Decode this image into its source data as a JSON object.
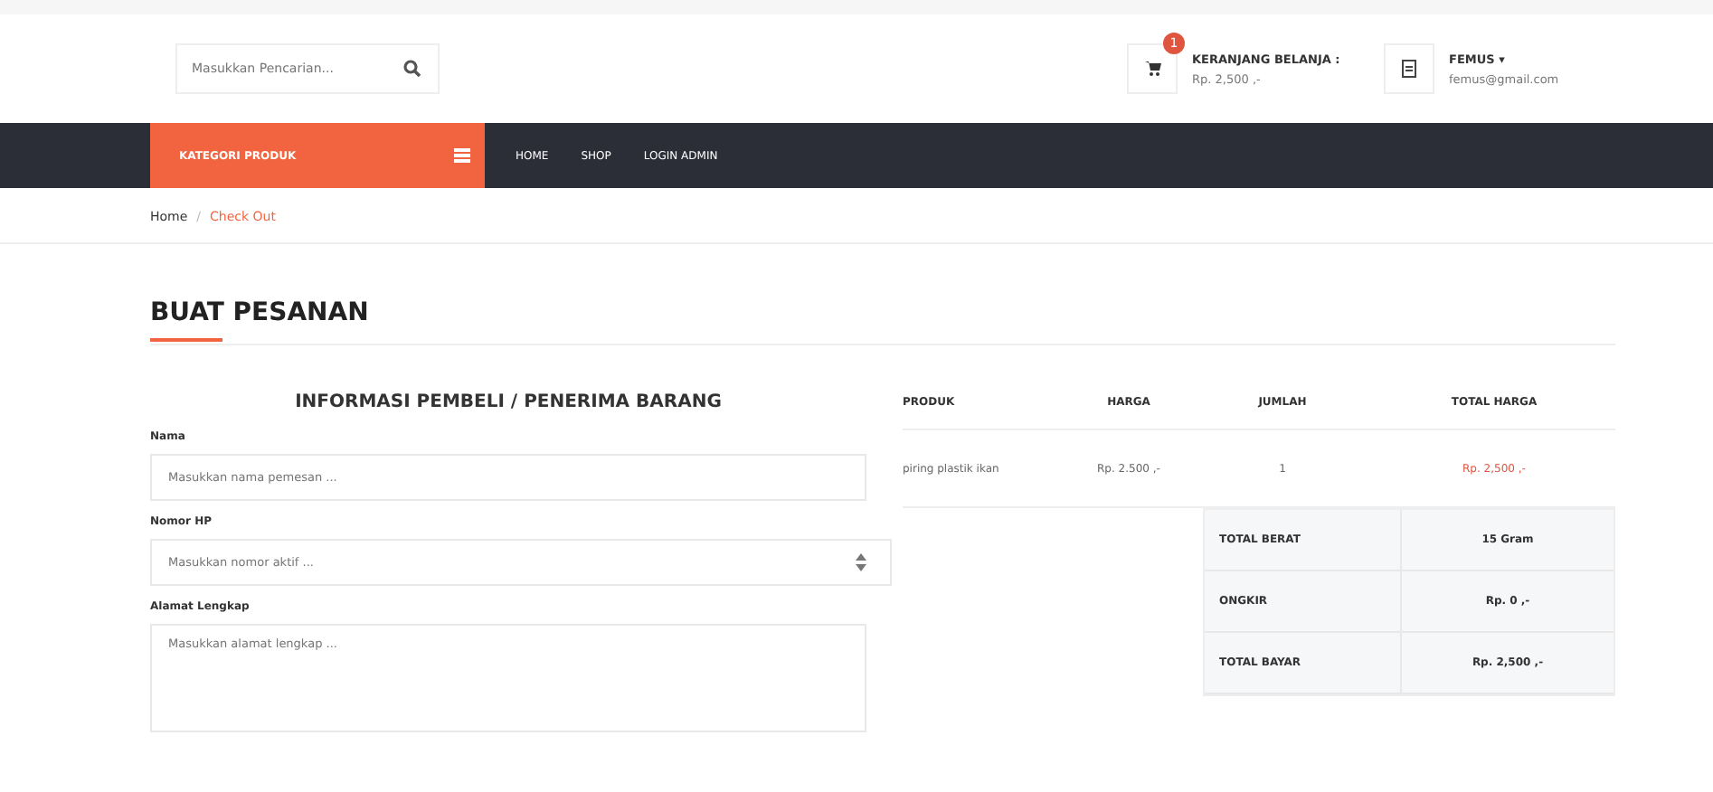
{
  "header": {
    "search": {
      "placeholder": "Masukkan Pencarian..."
    },
    "cart": {
      "badge": "1",
      "label": "KERANJANG BELANJA :",
      "total": "Rp. 2,500 ,-"
    },
    "user": {
      "name": "FEMUS",
      "caret": "▾",
      "email": "femus@gmail.com"
    }
  },
  "nav": {
    "category": "KATEGORI PRODUK",
    "links": [
      {
        "label": "HOME"
      },
      {
        "label": "SHOP"
      },
      {
        "label": "LOGIN ADMIN"
      }
    ]
  },
  "breadcrumb_separator": "/",
  "breadcrumb": [
    {
      "label": "Home",
      "selected": false
    },
    {
      "label": "Check Out",
      "selected": true
    }
  ],
  "page_title": "BUAT PESANAN",
  "form": {
    "title": "INFORMASI PEMBELI / PENERIMA BARANG",
    "fields": [
      {
        "kind": "input",
        "label": "Nama",
        "placeholder": "Masukkan nama pemesan ..."
      },
      {
        "kind": "number",
        "label": "Nomor HP",
        "placeholder": "Masukkan nomor aktif ..."
      },
      {
        "kind": "textarea",
        "label": "Alamat Lengkap",
        "placeholder": "Masukkan alamat lengkap ..."
      }
    ]
  },
  "order": {
    "columns": [
      "PRODUK",
      "HARGA",
      "JUMLAH",
      "TOTAL HARGA"
    ],
    "rows": [
      {
        "product": "piring plastik ikan",
        "price": "Rp. 2.500 ,-",
        "qty": "1",
        "total": "Rp. 2,500 ,-"
      }
    ],
    "summary": [
      {
        "label": "TOTAL BERAT",
        "value": "15 Gram"
      },
      {
        "label": "ONGKIR",
        "value": "Rp. 0 ,-"
      },
      {
        "label": "TOTAL BAYAR",
        "value": "Rp. 2,500 ,-"
      }
    ]
  }
}
